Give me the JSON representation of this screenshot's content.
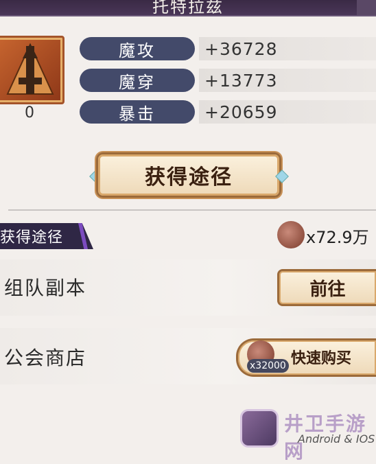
{
  "header": {
    "title": "托特拉兹"
  },
  "item": {
    "count": "0"
  },
  "stats": [
    {
      "label": "魔攻",
      "value": "+36728"
    },
    {
      "label": "魔穿",
      "value": "+13773"
    },
    {
      "label": "暴击",
      "value": "+20659"
    }
  ],
  "obtain_button": {
    "label": "获得途径"
  },
  "section": {
    "title": "获得途径"
  },
  "currency": {
    "amount": "x72.9万"
  },
  "sources": [
    {
      "label": "组队副本",
      "action": "前往"
    },
    {
      "label": "公会商店",
      "action": "快速购买",
      "cost": "x32000"
    }
  ],
  "watermark": {
    "site": "井卫手游网",
    "platform": "Android & IOS"
  }
}
